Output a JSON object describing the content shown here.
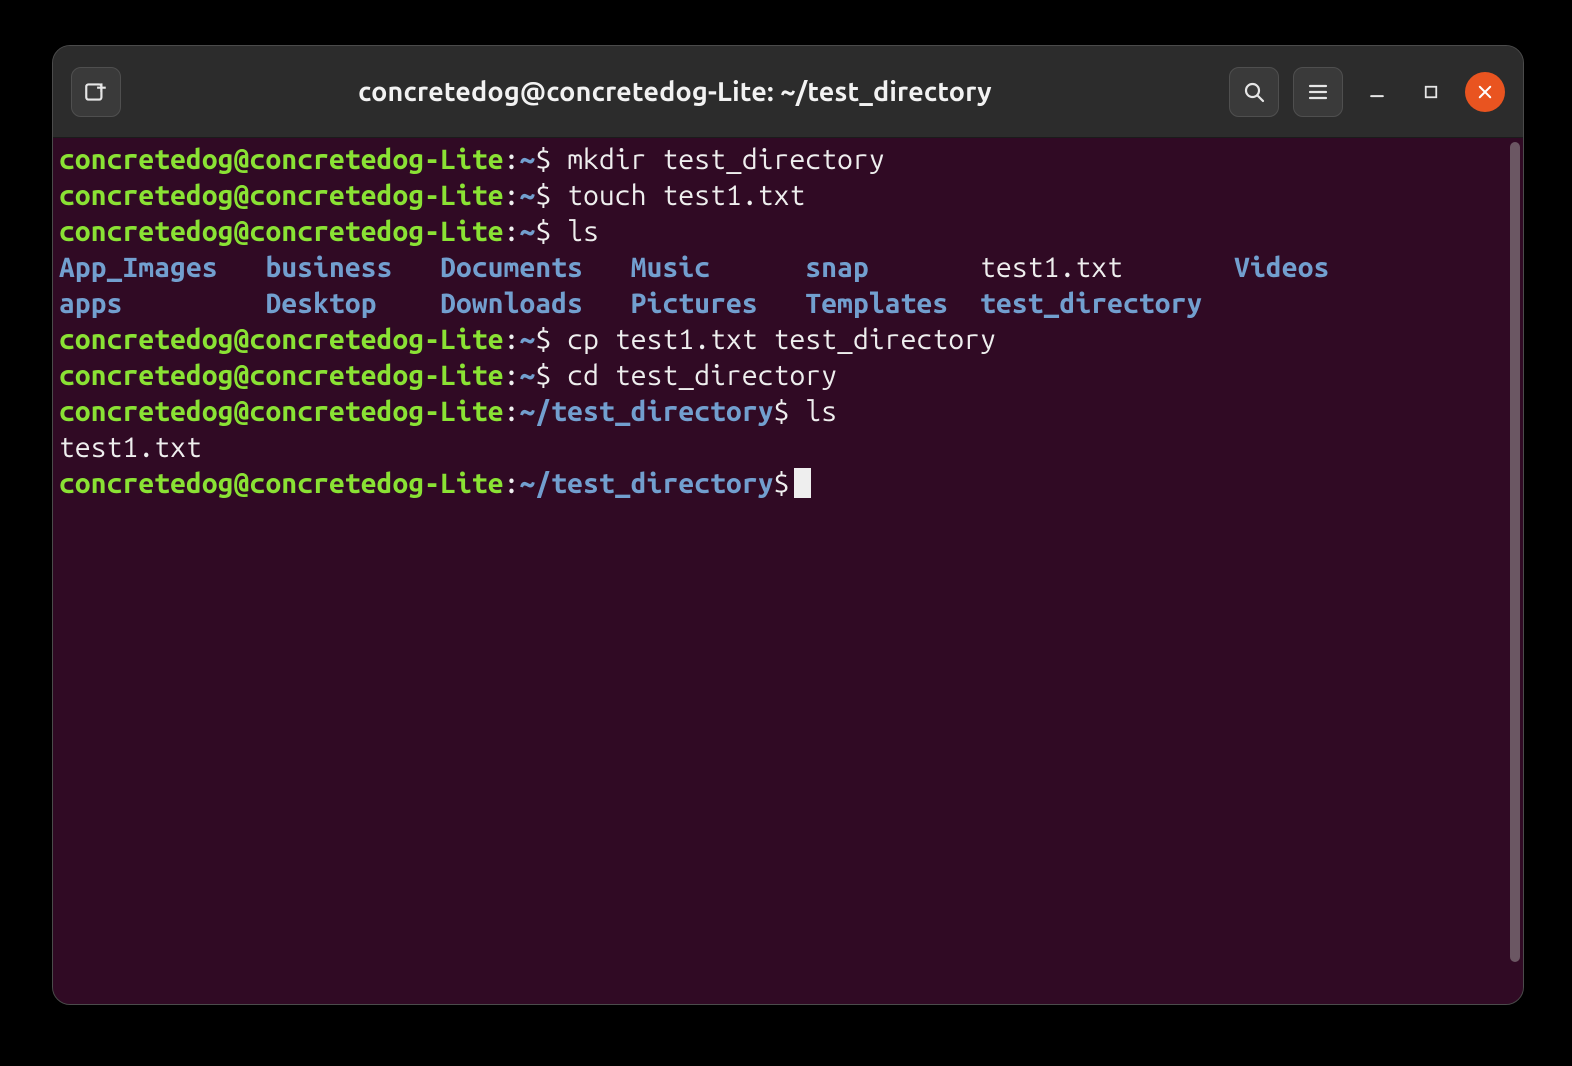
{
  "window": {
    "title": "concretedog@concretedog-Lite: ~/test_directory"
  },
  "colors": {
    "terminal_bg": "#300a24",
    "user": "#8ae234",
    "path": "#729fcf",
    "text": "#eeeeee",
    "close_btn": "#e95420",
    "chrome_bg": "#2c2c2c"
  },
  "icons": {
    "new_tab": "new-tab-icon",
    "search": "search-icon",
    "menu": "hamburger-menu-icon",
    "minimize": "minimize-icon",
    "maximize": "maximize-icon",
    "close": "close-icon"
  },
  "prompt": {
    "user_host": "concretedog@concretedog-Lite",
    "colon": ":",
    "home": "~",
    "subdir": "~/test_directory",
    "dollar": "$ ",
    "dollar_alone": "$"
  },
  "lines": [
    {
      "type": "prompt_home",
      "command": "mkdir test_directory"
    },
    {
      "type": "prompt_home",
      "command": "touch test1.txt"
    },
    {
      "type": "prompt_home",
      "command": "ls"
    }
  ],
  "ls_output": {
    "row1": [
      {
        "name": "App_Images",
        "cls": "d",
        "pad": "App_Images   "
      },
      {
        "name": "business",
        "cls": "d",
        "pad": "business   "
      },
      {
        "name": "Documents",
        "cls": "d",
        "pad": "Documents   "
      },
      {
        "name": "Music",
        "cls": "d",
        "pad": "Music      "
      },
      {
        "name": "snap",
        "cls": "d",
        "pad": "snap       "
      },
      {
        "name": "test1.txt",
        "cls": "f",
        "pad": "test1.txt       "
      },
      {
        "name": "Videos",
        "cls": "d",
        "pad": "Videos"
      }
    ],
    "row2": [
      {
        "name": "apps",
        "cls": "d",
        "pad": "apps         "
      },
      {
        "name": "Desktop",
        "cls": "d",
        "pad": "Desktop    "
      },
      {
        "name": "Downloads",
        "cls": "d",
        "pad": "Downloads   "
      },
      {
        "name": "Pictures",
        "cls": "d",
        "pad": "Pictures   "
      },
      {
        "name": "Templates",
        "cls": "d",
        "pad": "Templates  "
      },
      {
        "name": "test_directory",
        "cls": "d",
        "pad": "test_directory"
      }
    ]
  },
  "lines2": [
    {
      "type": "prompt_home",
      "command": "cp test1.txt test_directory"
    },
    {
      "type": "prompt_home",
      "command": "cd test_directory"
    },
    {
      "type": "prompt_sub",
      "command": "ls"
    }
  ],
  "ls2_output": "test1.txt",
  "final_prompt": {
    "type": "prompt_sub_empty"
  }
}
